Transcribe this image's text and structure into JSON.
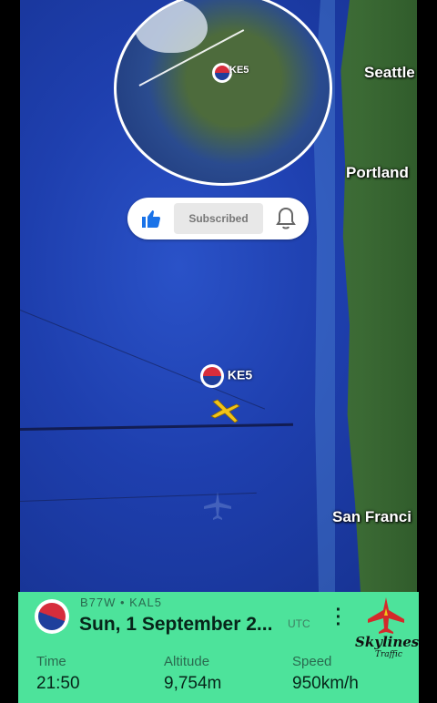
{
  "map": {
    "cities": [
      {
        "name": "Seattle"
      },
      {
        "name": "Portland"
      },
      {
        "name": "San Franci"
      }
    ],
    "globe_flight_label": "KE5",
    "flight_label": "KE5"
  },
  "subscribe": {
    "label": "Subscribed"
  },
  "flight_panel": {
    "aircraft_code": "B77W • KAL5",
    "date": "Sun, 1 September 2...",
    "timezone": "UTC",
    "stats": [
      {
        "label": "Time",
        "value": "21:50"
      },
      {
        "label": "Altitude",
        "value": "9,754m"
      },
      {
        "label": "Speed",
        "value": "950km/h"
      }
    ]
  },
  "brand": {
    "name": "Skylines",
    "subtitle": "Traffic"
  },
  "colors": {
    "ocean": "#1e3fae",
    "panel": "#4de39b",
    "plane": "#f2c318",
    "like_blue": "#1a73e8"
  }
}
